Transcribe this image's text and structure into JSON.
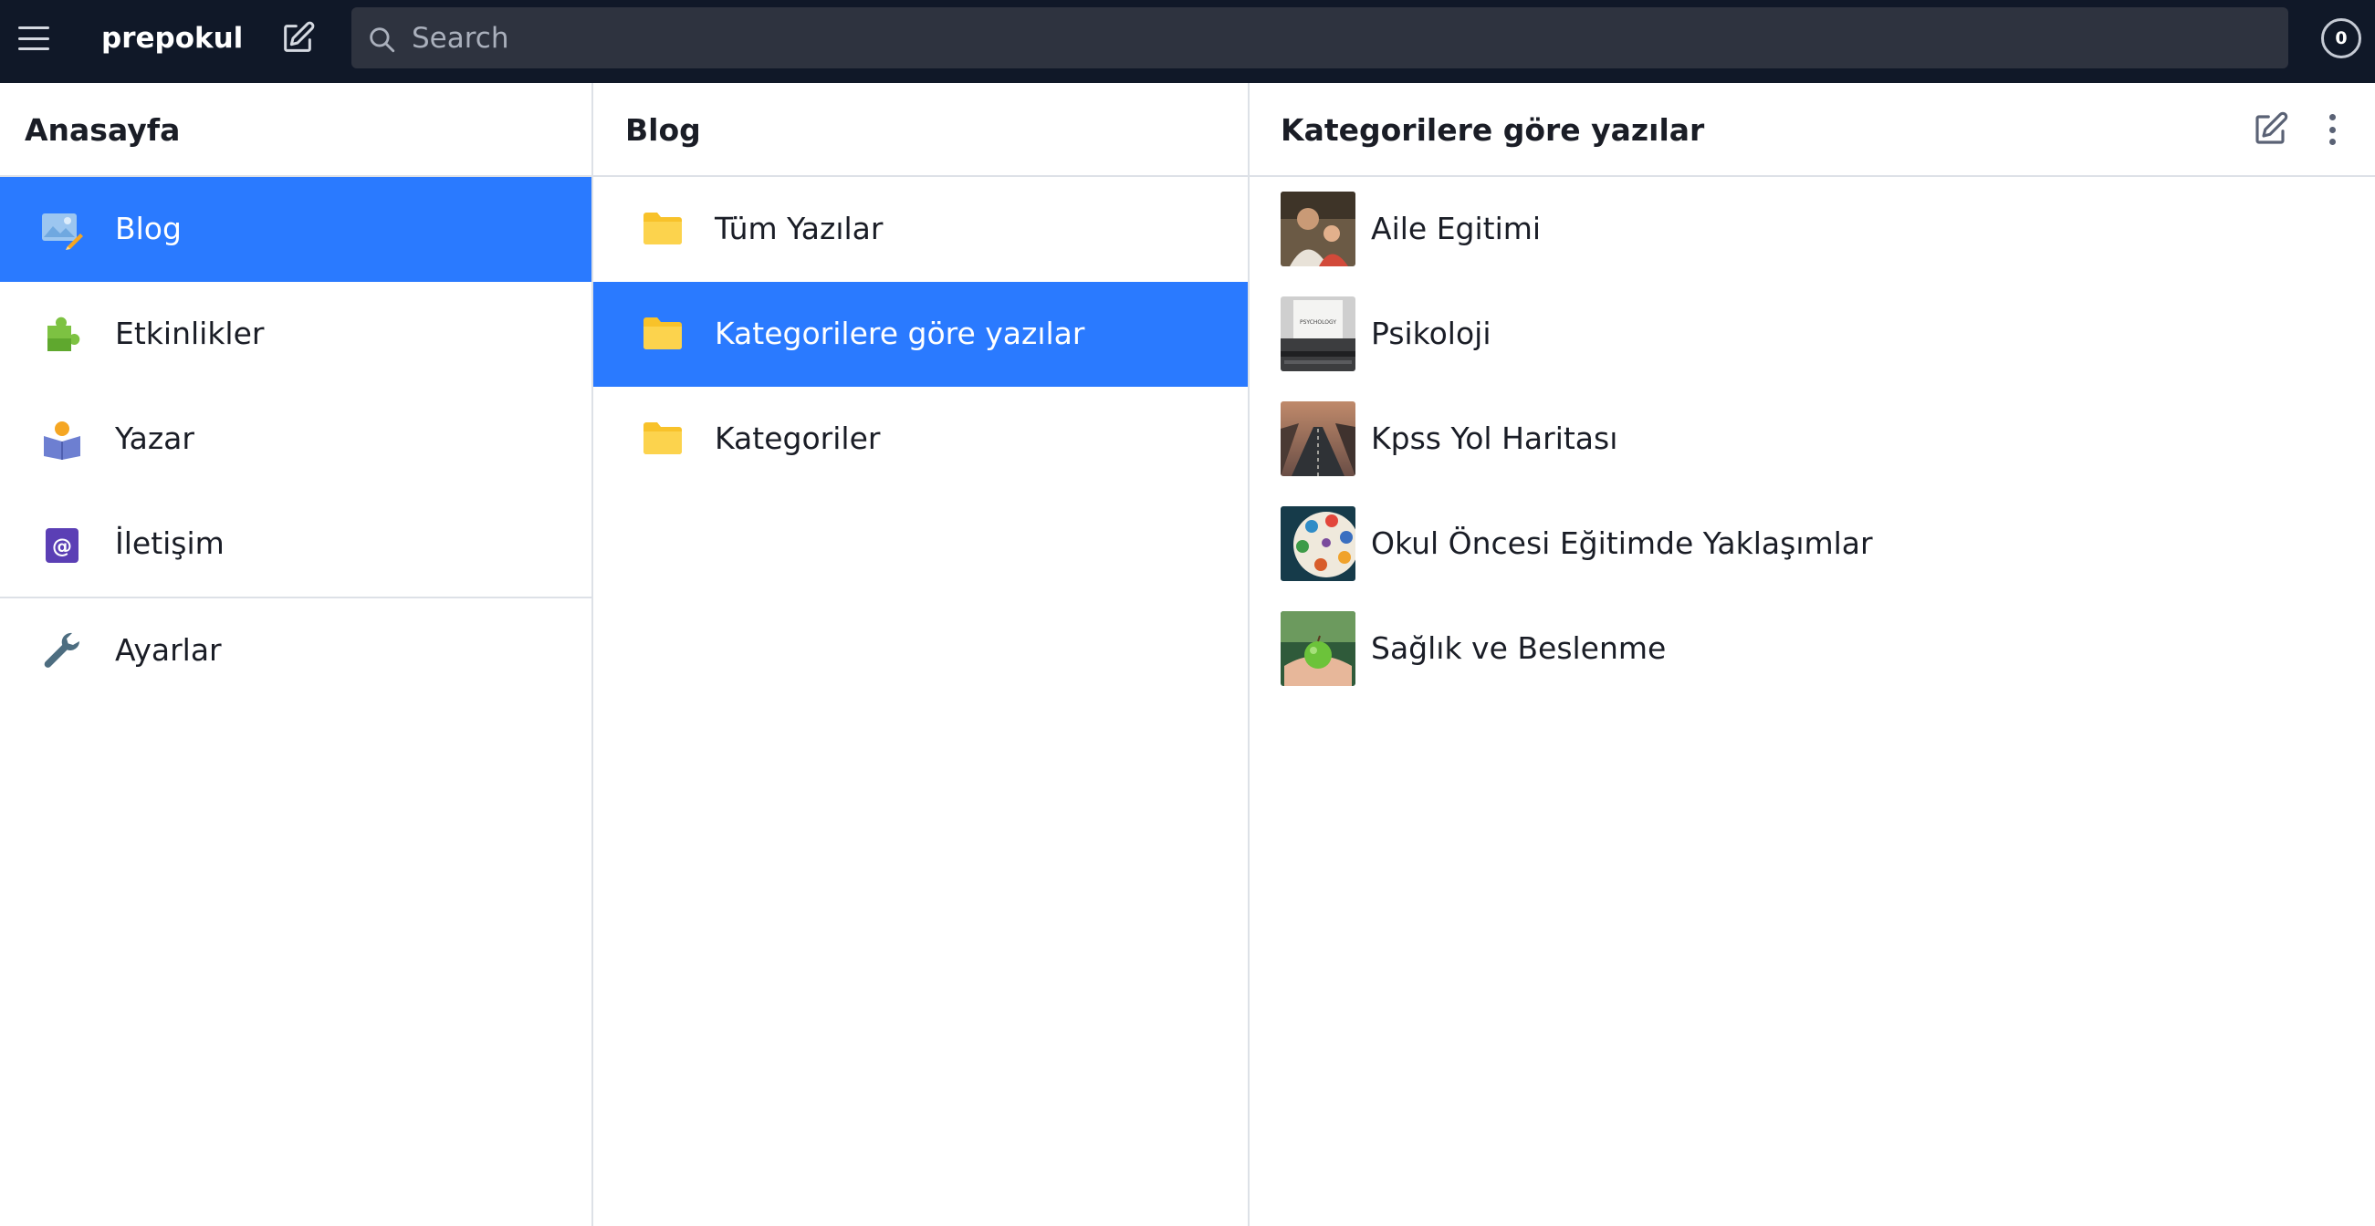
{
  "topbar": {
    "brand": "prepokul",
    "search_placeholder": "Search",
    "notification_count": "0"
  },
  "column1": {
    "title": "Anasayfa",
    "items": [
      {
        "label": "Blog",
        "icon": "image-edit-icon",
        "active": true
      },
      {
        "label": "Etkinlikler",
        "icon": "puzzle-icon",
        "active": false
      },
      {
        "label": "Yazar",
        "icon": "reader-icon",
        "active": false
      },
      {
        "label": "İletişim",
        "icon": "at-sign-icon",
        "active": false
      }
    ],
    "settings": {
      "label": "Ayarlar",
      "icon": "wrench-icon"
    }
  },
  "column2": {
    "title": "Blog",
    "items": [
      {
        "label": "Tüm Yazılar",
        "icon": "folder-icon",
        "active": false
      },
      {
        "label": "Kategorilere göre yazılar",
        "icon": "folder-icon",
        "active": true
      },
      {
        "label": "Kategoriler",
        "icon": "folder-icon",
        "active": false
      }
    ]
  },
  "column3": {
    "title": "Kategorilere göre yazılar",
    "items": [
      {
        "label": "Aile Egitimi",
        "thumb": "family-photo"
      },
      {
        "label": "Psikoloji",
        "thumb": "typewriter-psychology-photo"
      },
      {
        "label": "Kpss Yol Haritası",
        "thumb": "road-photo"
      },
      {
        "label": "Okul Öncesi Eğitimde Yaklaşımlar",
        "thumb": "paint-palette-photo"
      },
      {
        "label": "Sağlık ve Beslenme",
        "thumb": "green-apple-photo"
      }
    ]
  },
  "colors": {
    "topbar_bg": "#101828",
    "active_row": "#2a7aff",
    "folder": "#f8c22a",
    "divider": "#dde1e7"
  }
}
